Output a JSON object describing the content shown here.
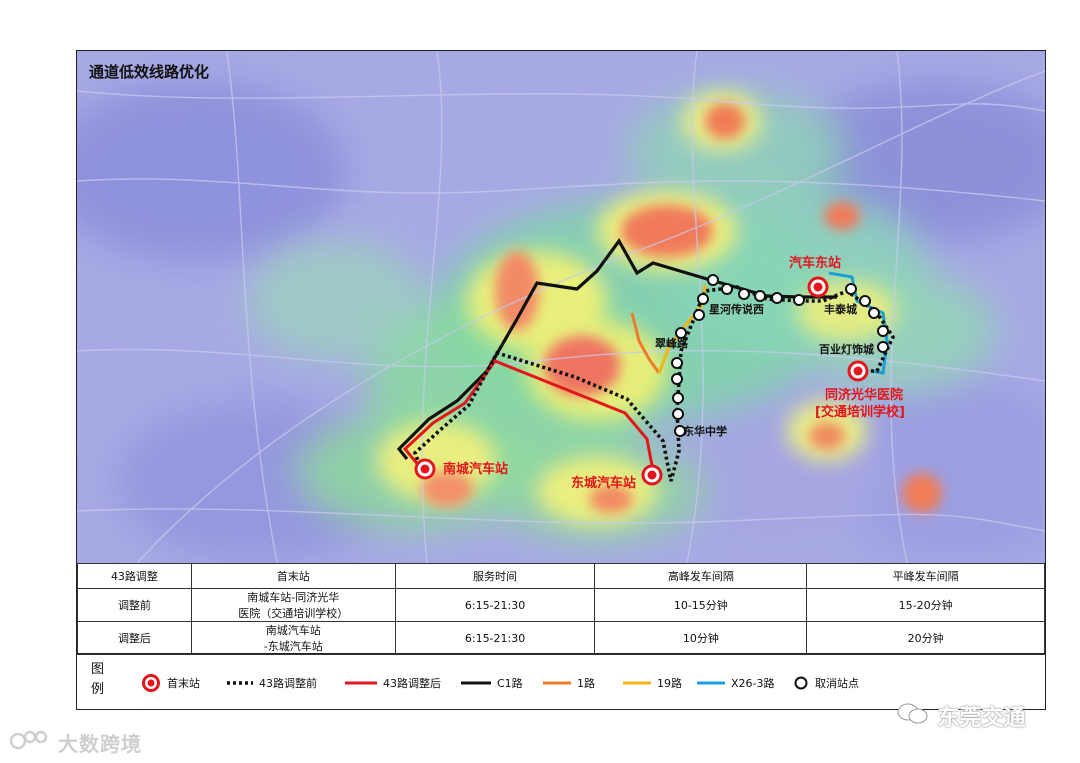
{
  "map": {
    "title": "通道低效线路优化",
    "stops": {
      "xinghe": "星河传说西",
      "fengtai": "丰泰城",
      "cuifeng": "翠峰路",
      "donghua": "东华中学",
      "baiye": "百业灯饰城"
    },
    "terminals": {
      "nancheng": "南城汽车站",
      "dongcheng": "东城汽车站",
      "qichedong": "汽车东站",
      "tongji_1": "同济光华医院",
      "tongji_2": "[交通培训学校]"
    }
  },
  "table": {
    "headers": [
      "43路调整",
      "首末站",
      "服务时间",
      "高峰发车间隔",
      "平峰发车间隔"
    ],
    "rows": [
      {
        "label": "调整前",
        "stations_1": "南城车站-同济光华",
        "stations_2": "医院（交通培训学校）",
        "time": "6:15-21:30",
        "peak": "10-15分钟",
        "offpeak": "15-20分钟"
      },
      {
        "label": "调整后",
        "stations_1": "南城汽车站",
        "stations_2": "-东城汽车站",
        "time": "6:15-21:30",
        "peak": "10分钟",
        "offpeak": "20分钟"
      }
    ]
  },
  "legend": {
    "title_1": "图",
    "title_2": "例",
    "items": {
      "terminal": "首末站",
      "before": "43路调整前",
      "after": "43路调整后",
      "c1": "C1路",
      "r1": "1路",
      "r19": "19路",
      "x26": "X26-3路",
      "cancel": "取消站点"
    }
  },
  "colors": {
    "route_after": "#e2161c",
    "route_c1": "#111111",
    "route_1": "#ee7a2a",
    "route_19": "#f2b517",
    "route_x26": "#1a9fd8",
    "heat_base": "#9b9de0"
  },
  "watermarks": {
    "left": "大数跨境",
    "right": "东莞交通"
  }
}
